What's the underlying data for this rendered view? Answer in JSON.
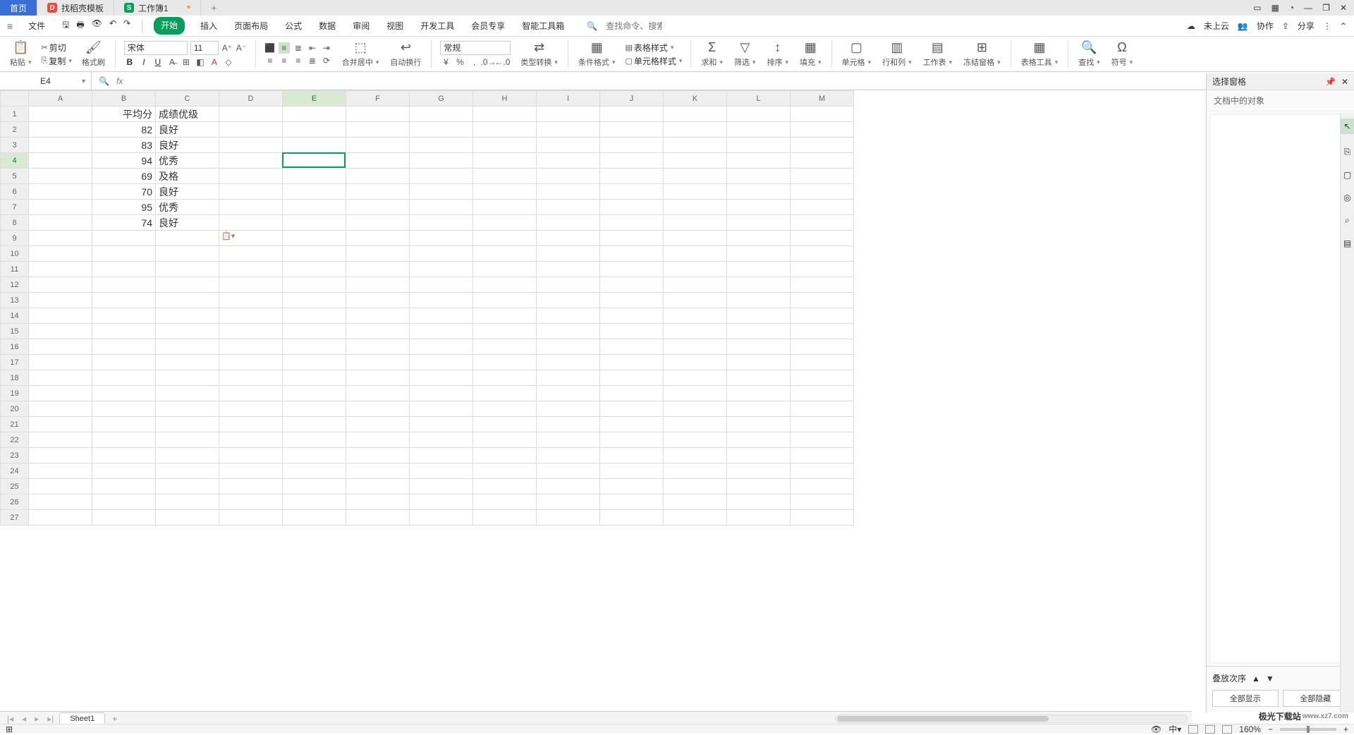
{
  "titlebar": {
    "home": "首页",
    "template_tab": "找稻壳模板",
    "doc_tab": "工作簿1",
    "template_icon": "D",
    "doc_icon": "S"
  },
  "menubar": {
    "file": "文件",
    "tabs": [
      "开始",
      "插入",
      "页面布局",
      "公式",
      "数据",
      "审阅",
      "视图",
      "开发工具",
      "会员专享",
      "智能工具箱"
    ],
    "search_cmd": "查找命令、搜索模板",
    "cloud": "未上云",
    "coop": "协作",
    "share": "分享"
  },
  "ribbon": {
    "paste": "粘贴",
    "cut": "剪切",
    "copy": "复制",
    "format_painter": "格式刷",
    "font_name": "宋体",
    "font_size": "11",
    "merge": "合并居中",
    "wrap": "自动换行",
    "numfmt": "常规",
    "type_conv": "类型转换",
    "cond_fmt": "条件格式",
    "table_style": "表格样式",
    "cell_style": "单元格样式",
    "sum": "求和",
    "filter": "筛选",
    "sort": "排序",
    "fill": "填充",
    "cell": "单元格",
    "rowcol": "行和列",
    "sheet": "工作表",
    "freeze": "冻结窗格",
    "table_tools": "表格工具",
    "find": "查找",
    "symbol": "符号"
  },
  "namebox": "E4",
  "columns": [
    "A",
    "B",
    "C",
    "D",
    "E",
    "F",
    "G",
    "H",
    "I",
    "J",
    "K",
    "L",
    "M"
  ],
  "rows": 27,
  "cells": {
    "B1": "平均分",
    "C1": "成绩优级",
    "B2": "82",
    "C2": "良好",
    "B3": "83",
    "C3": "良好",
    "B4": "94",
    "C4": "优秀",
    "B5": "69",
    "C5": "及格",
    "B6": "70",
    "C6": "良好",
    "B7": "95",
    "C7": "优秀",
    "B8": "74",
    "C8": "良好"
  },
  "selected": {
    "col": "E",
    "row": 4
  },
  "rightpane": {
    "title": "选择窗格",
    "subtitle": "文档中的对象",
    "stack": "叠放次序",
    "show_all": "全部显示",
    "hide_all": "全部隐藏"
  },
  "sheet": {
    "name": "Sheet1"
  },
  "status": {
    "zoom": "160%"
  },
  "logo": {
    "brand": "极光下载站",
    "url": "www.xz7.com"
  }
}
